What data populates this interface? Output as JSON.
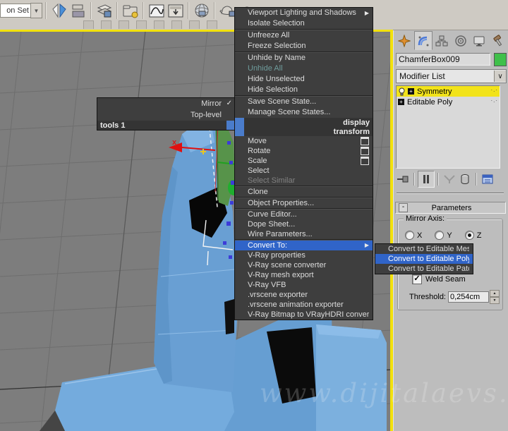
{
  "toolbar": {
    "selection_set_value": "on Set",
    "icons": [
      "mirror-icon",
      "align-icon",
      "layer-manager-icon",
      "asset-browser-icon",
      "curve-editor-icon",
      "schematic-view-icon",
      "render-setup-icon",
      "rendered-frame-window-icon",
      "render-production-icon"
    ]
  },
  "glyphs": {
    "combo_arrow": "▼",
    "list_arrow": "∨",
    "submenu_arrow": "▶",
    "check": "✓",
    "collapse": "-",
    "spinner_up": "▲",
    "spinner_down": "▼",
    "checkbox_check": "✓"
  },
  "quad_menu": {
    "left_quad": {
      "items": [
        {
          "label": "Mirror",
          "check": "✓"
        },
        {
          "label": "Top-level",
          "check": ""
        }
      ],
      "header": "tools 1"
    },
    "display_header": "display",
    "transform_header": "transform",
    "display_items": [
      {
        "label": "Viewport Lighting and Shadows"
      },
      {
        "label": "Isolate Selection"
      },
      {
        "label": "Unfreeze All"
      },
      {
        "label": "Freeze Selection"
      },
      {
        "label": "Unhide by Name"
      },
      {
        "label": "Unhide All"
      },
      {
        "label": "Hide Unselected"
      },
      {
        "label": "Hide Selection"
      },
      {
        "label": "Save Scene State..."
      },
      {
        "label": "Manage Scene States..."
      }
    ],
    "transform_items": [
      {
        "label": "Move"
      },
      {
        "label": "Rotate"
      },
      {
        "label": "Scale"
      },
      {
        "label": "Select"
      },
      {
        "label": "Select Similar"
      },
      {
        "label": "Clone"
      },
      {
        "label": "Object Properties..."
      },
      {
        "label": "Curve Editor..."
      },
      {
        "label": "Dope Sheet..."
      },
      {
        "label": "Wire Parameters..."
      },
      {
        "label": "Convert To:"
      },
      {
        "label": "V-Ray properties"
      },
      {
        "label": "V-Ray scene converter"
      },
      {
        "label": "V-Ray mesh export"
      },
      {
        "label": "V-Ray VFB"
      },
      {
        "label": ".vrscene exporter"
      },
      {
        "label": ".vrscene animation exporter"
      },
      {
        "label": "V-Ray Bitmap to VRayHDRI converter"
      }
    ],
    "submenu_items": [
      {
        "label": "Convert to Editable Mesh"
      },
      {
        "label": "Convert to Editable Poly"
      },
      {
        "label": "Convert to Editable Patch"
      }
    ]
  },
  "viewport": {
    "axis_label": "x",
    "watermark": "www.dijitalaevs.com"
  },
  "command_panel": {
    "object_name": "ChamferBox009",
    "modifier_list_label": "Modifier List",
    "stack": [
      {
        "name": "Symmetry"
      },
      {
        "name": "Editable Poly"
      }
    ],
    "parameters": {
      "title": "Parameters",
      "group_title": "Mirror Axis:",
      "radio_x": "X",
      "radio_y": "Y",
      "radio_z": "Z",
      "weld_seam_label": "Weld Seam",
      "threshold_label": "Threshold:",
      "threshold_value": "0,254cm"
    }
  },
  "colors": {
    "highlight_blue": "#3064c8",
    "quad_bg": "#3e3e3e",
    "stack_active_yellow": "#f2e31a",
    "object_color_swatch": "#3fc04a",
    "viewport_active_border": "#f2e10c"
  }
}
